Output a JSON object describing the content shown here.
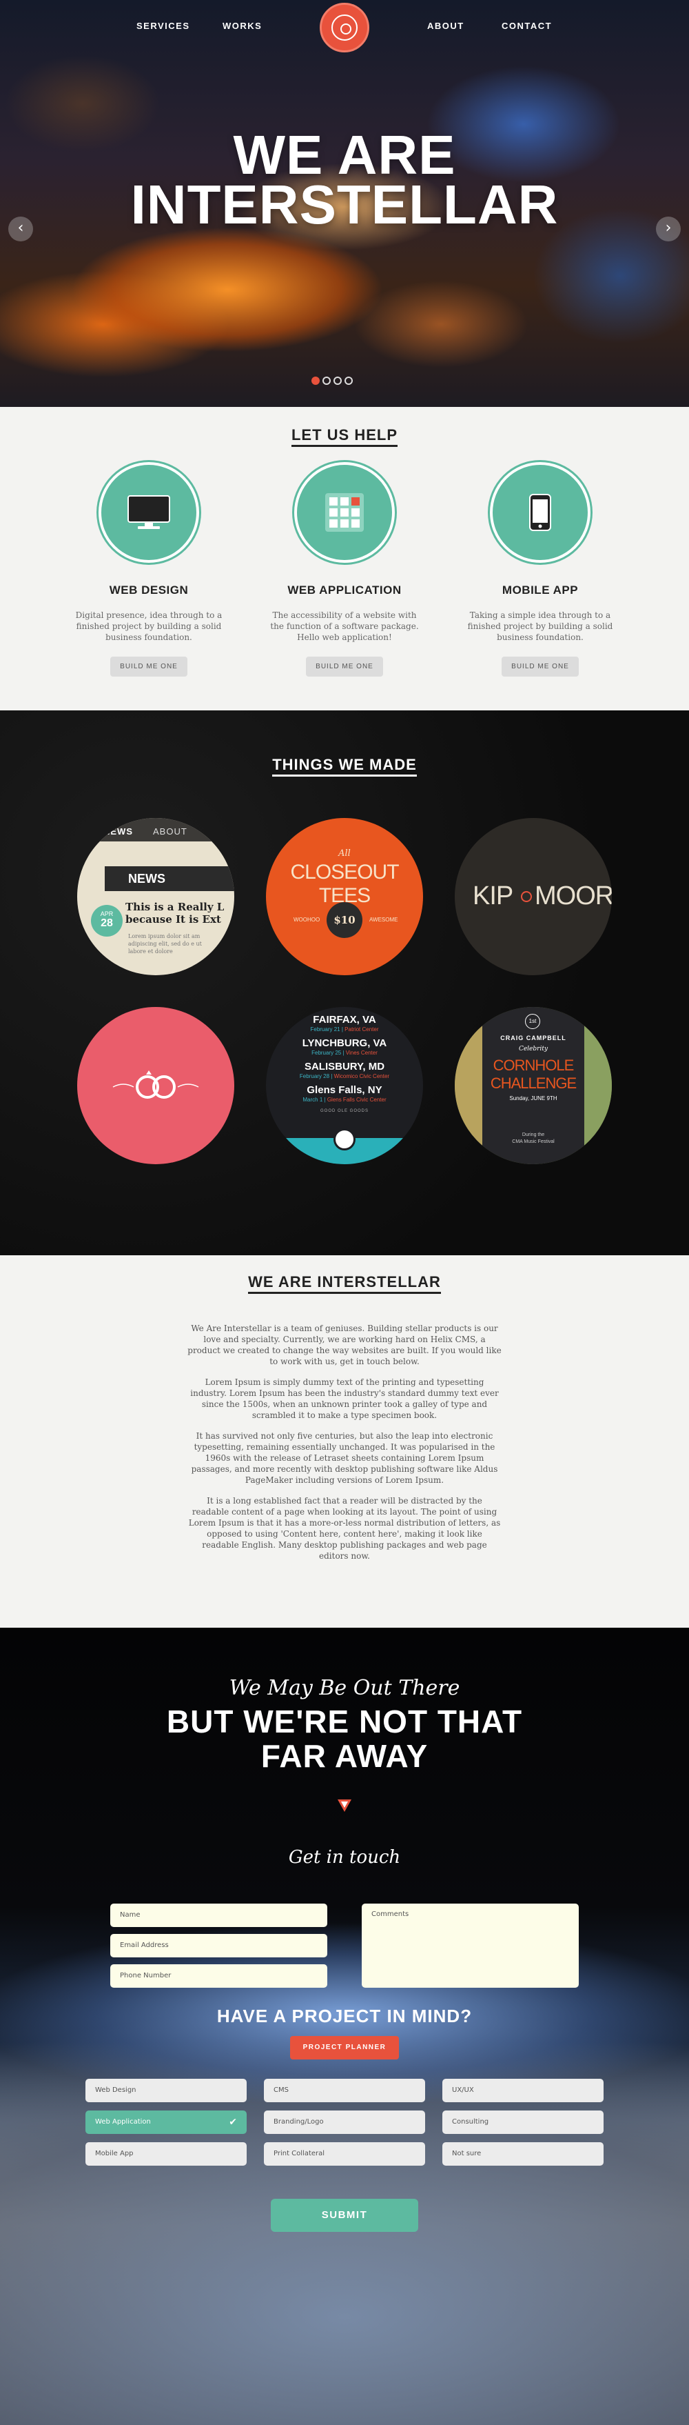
{
  "nav": {
    "services": "SERVICES",
    "works": "WORKS",
    "about": "ABOUT",
    "contact": "CONTACT"
  },
  "hero": {
    "line1": "WE ARE",
    "line2": "INTERSTELLAR",
    "prev": "‹",
    "next": "›",
    "slides": 4,
    "active_slide": 1
  },
  "help": {
    "title": "LET US HELP",
    "services": [
      {
        "title": "WEB DESIGN",
        "icon": "monitor-icon",
        "text": "Digital presence, idea through to a finished project by building a solid business foundation.",
        "button": "BUILD ME ONE"
      },
      {
        "title": "WEB APPLICATION",
        "icon": "app-grid-icon",
        "text": "The accessibility of a website with the function of a software package. Hello web application!",
        "button": "BUILD ME ONE"
      },
      {
        "title": "MOBILE APP",
        "icon": "smartphone-icon",
        "text": "Taking a simple idea through to a finished project by building a solid business foundation.",
        "button": "BUILD ME ONE"
      }
    ]
  },
  "works": {
    "title": "THINGS WE MADE",
    "news": {
      "tab1": "NEWS",
      "tab2": "ABOUT",
      "heading": "NEWS",
      "month": "APR",
      "day": "28",
      "headline": "This is a Really L because It is Ext",
      "body": "Lorem ipsum dolor sit am adipiscing elit, sed do e ut labore et dolore"
    },
    "closeout": {
      "small": "All",
      "title": "CLOSEOUT TEES",
      "left": "WOOHOO",
      "number": "$10",
      "right": "AWESOME"
    },
    "kip": {
      "left": "KIP",
      "right": "MOORE"
    },
    "tour": [
      {
        "city": "FAIRFAX, VA",
        "date": "February 21",
        "venue": "Patriot Center"
      },
      {
        "city": "LYNCHBURG, VA",
        "date": "February 25",
        "venue": "Vines Center"
      },
      {
        "city": "SALISBURY, MD",
        "date": "February 28",
        "venue": "Wicomico Civic Center"
      },
      {
        "city": "Glens Falls, NY",
        "date": "March 1",
        "venue": "Glens Falls Civic Center"
      }
    ],
    "tour_footer": "GOOD OLE GOODS",
    "cornhole": {
      "badge": "1st",
      "name": "CRAIG CAMPBELL",
      "celebrity": "Celebrity",
      "title1": "CORNHOLE",
      "title2": "CHALLENGE",
      "date": "Sunday, JUNE 9TH",
      "footer1": "During the",
      "footer2": "CMA Music Festival"
    }
  },
  "about": {
    "title": "WE ARE INTERSTELLAR",
    "paragraphs": [
      "We Are Interstellar is a team of geniuses. Building stellar products is our love and specialty. Currently, we are working hard on Helix CMS, a product we created to change the way websites are built. If you would like to work with us, get in touch below.",
      "Lorem Ipsum is simply dummy text of the printing and typesetting industry. Lorem Ipsum has been the industry's standard dummy text ever since the 1500s, when an unknown printer took a galley of type and scrambled it to make a type specimen book.",
      "It has survived not only five centuries, but also the leap into electronic typesetting, remaining essentially unchanged. It was popularised in the 1960s with the release of Letraset sheets containing Lorem Ipsum passages, and more recently with desktop publishing software like Aldus PageMaker including versions of Lorem Ipsum.",
      "It is a long established fact that a reader will be distracted by the readable content of a page when looking at its layout. The point of using Lorem Ipsum is that it has a more-or-less normal distribution of letters, as opposed to using 'Content here, content here', making it look like readable English. Many desktop publishing packages and web page editors now."
    ]
  },
  "contact": {
    "script": "We May Be Out There",
    "line1": "BUT WE'RE NOT THAT",
    "line2": "FAR AWAY",
    "touch": "Get in touch",
    "name": "Name",
    "email": "Email Address",
    "phone": "Phone Number",
    "comments": "Comments",
    "project": "HAVE A PROJECT IN MIND?",
    "planner": "PROJECT PLANNER",
    "options": [
      {
        "label": "Web Design",
        "selected": false
      },
      {
        "label": "CMS",
        "selected": false
      },
      {
        "label": "UX/UX",
        "selected": false
      },
      {
        "label": "Web Application",
        "selected": true
      },
      {
        "label": "Branding/Logo",
        "selected": false
      },
      {
        "label": "Consulting",
        "selected": false
      },
      {
        "label": "Mobile App",
        "selected": false
      },
      {
        "label": "Print Collateral",
        "selected": false
      },
      {
        "label": "Not sure",
        "selected": false
      }
    ],
    "check": "✔",
    "submit": "SUBMIT"
  },
  "colors": {
    "accent": "#5dbaa0",
    "brand": "#e8523c",
    "dark": "#0d0d0d"
  }
}
